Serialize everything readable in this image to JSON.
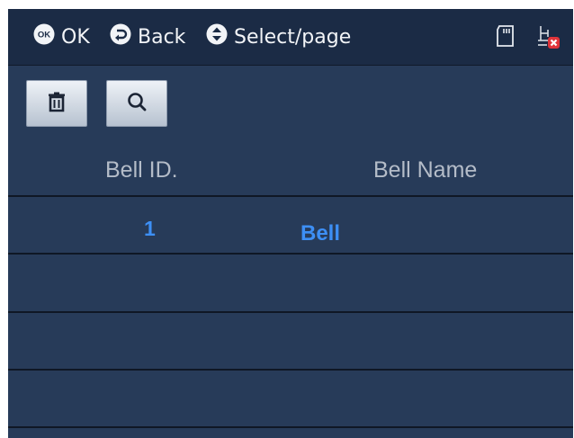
{
  "header": {
    "ok_icon_text": "OK",
    "ok_label": "OK",
    "back_label": "Back",
    "select_label": "Select/page",
    "icons": [
      "ok-icon",
      "back-icon",
      "select-page-icon",
      "sd-card-icon",
      "network-disconnected-icon"
    ]
  },
  "toolbar": {
    "buttons": [
      "delete-icon",
      "search-icon"
    ]
  },
  "table": {
    "columns": [
      "Bell ID.",
      "Bell Name"
    ],
    "rows": [
      {
        "id": "1",
        "name": "Bell"
      }
    ]
  },
  "colors": {
    "background": "#273b59",
    "header": "#1b2b45",
    "accent": "#3d8ff5",
    "header_text": "#b4bcc8"
  }
}
